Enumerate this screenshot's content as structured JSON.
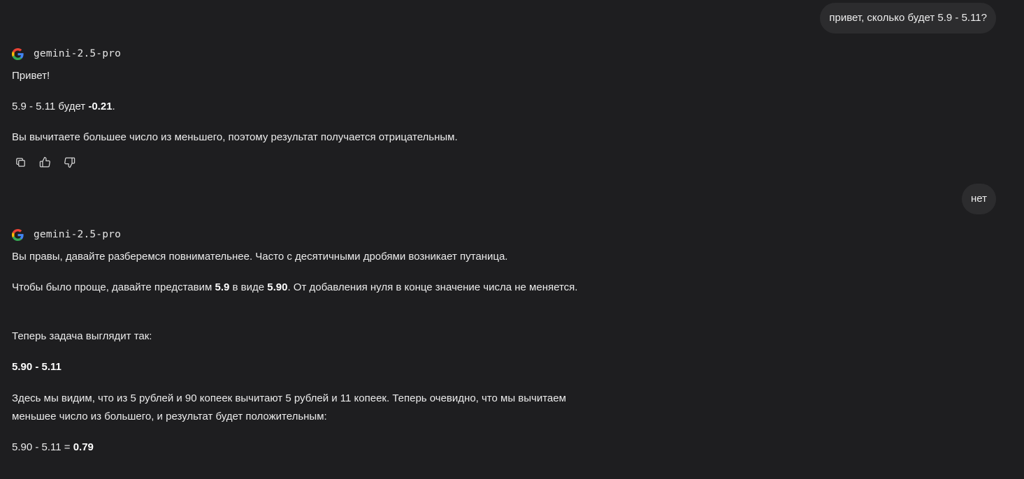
{
  "conversation": {
    "user_message_1": "привет, сколько будет 5.9 - 5.11?",
    "response_1": {
      "model": "gemini-2.5-pro",
      "line1": "Привет!",
      "line2_pre": "5.9 - 5.11 будет ",
      "line2_bold": "-0.21",
      "line2_post": ".",
      "line3": "Вы вычитаете большее число из меньшего, поэтому результат получается отрицательным.",
      "actions": [
        "copy-icon",
        "thumbs-up-icon",
        "thumbs-down-icon"
      ]
    },
    "user_message_2": "нет",
    "response_2": {
      "model": "gemini-2.5-pro",
      "p1": "Вы правы, давайте разберемся повнимательнее. Часто с десятичными дробями возникает путаница.",
      "p2_a": "Чтобы было проще, давайте представим ",
      "p2_b": "5.9",
      "p2_c": " в виде ",
      "p2_d": "5.90",
      "p2_e": ". От добавления нуля в конце значение числа не меняется.",
      "p3": "Теперь задача выглядит так:",
      "p4": "5.90 - 5.11",
      "p5": "Здесь мы видим, что из 5 рублей и 90 копеек вычитают 5 рублей и 11 копеек. Теперь очевидно, что мы вычитаем меньшее число из большего, и результат будет положительным:",
      "p6_pre": "5.90 - 5.11 = ",
      "p6_bold": "0.79"
    }
  },
  "colors": {
    "background": "#1e1e20",
    "bubble": "#2c2c2e",
    "text": "#ececec"
  }
}
